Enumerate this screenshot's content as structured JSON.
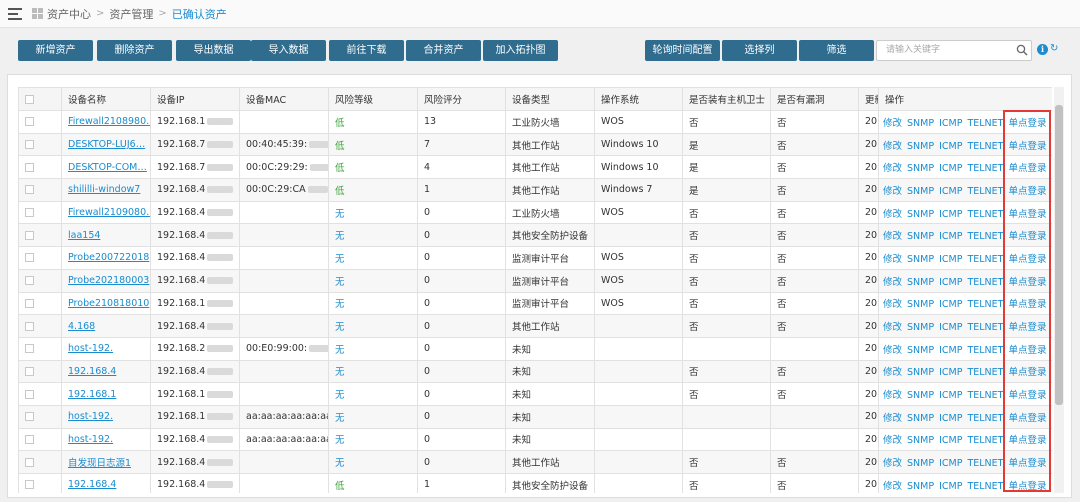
{
  "breadcrumb": {
    "items": [
      "资产中心",
      "资产管理",
      "已确认资产"
    ],
    "separator": ">"
  },
  "toolbar": {
    "left_buttons": [
      "新增资产",
      "删除资产",
      "导出数据",
      "导入数据",
      "前往下载",
      "合并资产",
      "加入拓扑图"
    ],
    "right_buttons": [
      "轮询时间配置",
      "选择列",
      "筛选"
    ],
    "search_placeholder": "请输入关键字",
    "info_glyph": "i",
    "refresh_glyph": "↻"
  },
  "table": {
    "columns": [
      "设备名称",
      "设备IP",
      "设备MAC",
      "风险等级",
      "风险评分",
      "设备类型",
      "操作系统",
      "是否装有主机卫士",
      "是否有漏洞",
      "更新",
      "操作"
    ],
    "operations": [
      "修改",
      "SNMP",
      "ICMP",
      "TELNET",
      "单点登录"
    ],
    "rows": [
      {
        "name": "Firewall2108980…",
        "ip": "192.168.1",
        "mac": "",
        "risk": "低",
        "score": "13",
        "type": "工业防火墙",
        "os": "WOS",
        "guard": "否",
        "vuln": "否",
        "upd": "20"
      },
      {
        "name": "DESKTOP-LUJ6…",
        "ip": "192.168.7",
        "mac": "00:40:45:39:",
        "risk": "低",
        "score": "7",
        "type": "其他工作站",
        "os": "Windows 10",
        "guard": "是",
        "vuln": "否",
        "upd": "20"
      },
      {
        "name": "DESKTOP-COM…",
        "ip": "192.168.7",
        "mac": "00:0C:29:29:",
        "risk": "低",
        "score": "4",
        "type": "其他工作站",
        "os": "Windows 10",
        "guard": "是",
        "vuln": "否",
        "upd": "20"
      },
      {
        "name": "shililli-window7",
        "ip": "192.168.4",
        "mac": "00:0C:29:CA",
        "risk": "低",
        "score": "1",
        "type": "其他工作站",
        "os": "Windows 7",
        "guard": "是",
        "vuln": "否",
        "upd": "20"
      },
      {
        "name": "Firewall2109080…",
        "ip": "192.168.4",
        "mac": "",
        "risk": "无",
        "score": "0",
        "type": "工业防火墙",
        "os": "WOS",
        "guard": "否",
        "vuln": "否",
        "upd": "20"
      },
      {
        "name": "laa154",
        "ip": "192.168.4",
        "mac": "",
        "risk": "无",
        "score": "0",
        "type": "其他安全防护设备",
        "os": "",
        "guard": "否",
        "vuln": "否",
        "upd": "20"
      },
      {
        "name": "Probe200722018",
        "ip": "192.168.4",
        "mac": "",
        "risk": "无",
        "score": "0",
        "type": "监测审计平台",
        "os": "WOS",
        "guard": "否",
        "vuln": "否",
        "upd": "20"
      },
      {
        "name": "Probe202180003",
        "ip": "192.168.4",
        "mac": "",
        "risk": "无",
        "score": "0",
        "type": "监测审计平台",
        "os": "WOS",
        "guard": "否",
        "vuln": "否",
        "upd": "20"
      },
      {
        "name": "Probe210818010",
        "ip": "192.168.1",
        "mac": "",
        "risk": "无",
        "score": "0",
        "type": "监测审计平台",
        "os": "WOS",
        "guard": "否",
        "vuln": "否",
        "upd": "20"
      },
      {
        "name": "4.168",
        "ip": "192.168.4",
        "mac": "",
        "risk": "无",
        "score": "0",
        "type": "其他工作站",
        "os": "",
        "guard": "否",
        "vuln": "否",
        "upd": "20"
      },
      {
        "name": "host-192.",
        "ip": "192.168.2",
        "mac": "00:E0:99:00:",
        "risk": "无",
        "score": "0",
        "type": "未知",
        "os": "",
        "guard": "",
        "vuln": "",
        "upd": "20"
      },
      {
        "name": "192.168.4",
        "ip": "192.168.4",
        "mac": "",
        "risk": "无",
        "score": "0",
        "type": "未知",
        "os": "",
        "guard": "否",
        "vuln": "否",
        "upd": "20"
      },
      {
        "name": "192.168.1",
        "ip": "192.168.1",
        "mac": "",
        "risk": "无",
        "score": "0",
        "type": "未知",
        "os": "",
        "guard": "否",
        "vuln": "否",
        "upd": "20"
      },
      {
        "name": "host-192.",
        "ip": "192.168.1",
        "mac": "aa:aa:aa:aa:aa:aa",
        "risk": "无",
        "score": "0",
        "type": "未知",
        "os": "",
        "guard": "",
        "vuln": "",
        "upd": "20"
      },
      {
        "name": "host-192.",
        "ip": "192.168.4",
        "mac": "aa:aa:aa:aa:aa:aa",
        "risk": "无",
        "score": "0",
        "type": "未知",
        "os": "",
        "guard": "",
        "vuln": "",
        "upd": "20"
      },
      {
        "name": "自发现日志源1",
        "ip": "192.168.4",
        "mac": "",
        "risk": "无",
        "score": "0",
        "type": "其他工作站",
        "os": "",
        "guard": "否",
        "vuln": "否",
        "upd": "20"
      },
      {
        "name": "192.168.4",
        "ip": "192.168.4",
        "mac": "",
        "risk": "低",
        "score": "1",
        "type": "其他安全防护设备",
        "os": "",
        "guard": "否",
        "vuln": "否",
        "upd": "20"
      }
    ]
  },
  "colors": {
    "button_bg": "#2f6c8e",
    "link": "#1a8ccf",
    "risk_low": "#3aa33a",
    "highlight_box": "#e53935"
  }
}
